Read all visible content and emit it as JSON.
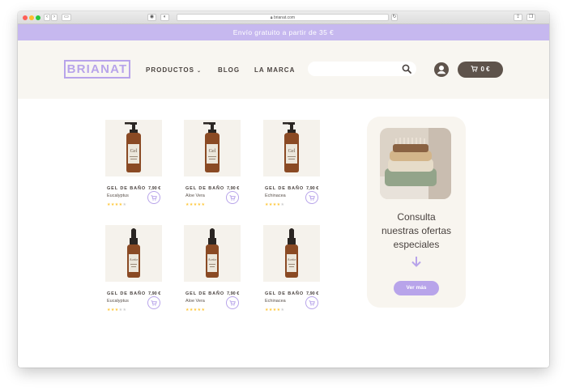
{
  "browser": {
    "url": "brianat.com"
  },
  "promo_bar": {
    "text": "Envío gratuito a partir de 35 €"
  },
  "header": {
    "logo": "BRIANAT",
    "nav": {
      "productos": "PRODUCTOS",
      "blog": "BLOG",
      "marca": "LA MARCA"
    },
    "search": {
      "placeholder": ""
    },
    "cart_total": "0 €"
  },
  "products": [
    {
      "name": "GEL DE BAÑO",
      "variant": "Eucalyptus",
      "price": "7,90 €",
      "rating": 4,
      "type": "gel"
    },
    {
      "name": "GEL DE BAÑO",
      "variant": "Aloe Vera",
      "price": "7,90 €",
      "rating": 5,
      "type": "gel"
    },
    {
      "name": "GEL DE BAÑO",
      "variant": "Echinacea",
      "price": "7,90 €",
      "rating": 4,
      "type": "gel"
    },
    {
      "name": "GEL DE BAÑO",
      "variant": "Eucalyptus",
      "price": "7,90 €",
      "rating": 3,
      "type": "dropper"
    },
    {
      "name": "GEL DE BAÑO",
      "variant": "Aloe Vera",
      "price": "7,90 €",
      "rating": 5,
      "type": "dropper"
    },
    {
      "name": "GEL DE BAÑO",
      "variant": "Echinacea",
      "price": "7,90 €",
      "rating": 4,
      "type": "dropper"
    }
  ],
  "offer_card": {
    "text_line1": "Consulta",
    "text_line2": "nuestras ofertas",
    "text_line3": "especiales",
    "button": "Ver más"
  },
  "colors": {
    "accent": "#b8a4ea",
    "promo_bg": "#c6b8ef",
    "header_bg": "#f8f6f1",
    "cart_bg": "#5e534b",
    "star": "#ffc83d"
  }
}
